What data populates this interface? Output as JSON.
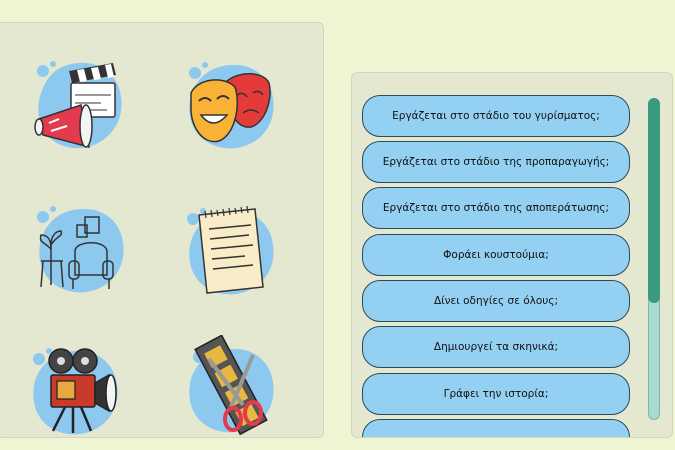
{
  "icons": [
    {
      "name": "film-clapper-megaphone-icon"
    },
    {
      "name": "theater-masks-icon"
    },
    {
      "name": "armchair-set-icon"
    },
    {
      "name": "script-notepad-icon"
    },
    {
      "name": "movie-projector-icon"
    },
    {
      "name": "film-strip-scissors-icon"
    }
  ],
  "questions": [
    "Εργάζεται στο στάδιο του γυρίσματος;",
    "Εργάζεται στο στάδιο της προπαραγωγής;",
    "Εργάζεται στο στάδιο της αποπεράτωσης;",
    "Φοράει κουστούμια;",
    "Δίνει οδηγίες σε όλους;",
    "Δημιουργεί τα σκηνικά;",
    "Γράφει την ιστορία;",
    ""
  ],
  "colors": {
    "background": "#eff5d2",
    "panel": "#e5e8d1",
    "button": "#94d0f2",
    "blob": "#8dc9ef",
    "scroll_thumb": "#3a9a80",
    "scroll_track": "#a9d9cf"
  }
}
